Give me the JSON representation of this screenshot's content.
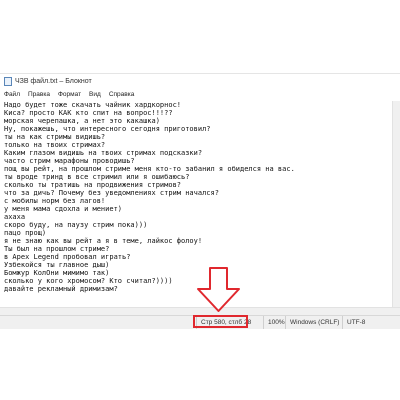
{
  "window": {
    "title": "ЧЗВ файл.txt – Блокнот"
  },
  "menu": {
    "items": [
      "Файл",
      "Правка",
      "Формат",
      "Вид",
      "Справка"
    ]
  },
  "editor": {
    "lines": [
      "Надо будет тоже скачать чайник хардкорнос!",
      "Киса? просто КАК кто спит на вопрос!!!??",
      "морская черепашка, а нет это какашка)",
      "Ну, покажешь, что интересного сегодня приготовил?",
      "ты на как стримы видишь?",
      "только на твоих стримах?",
      "Каким глазом видишь на твоих стримах подсказки?",
      "часто стрим марафоны проводишь?",
      "пощ вы рейт, на прошлом стриме меня кто-то забанил я обиделся на вас.",
      "ты вроде тринд в все стримил или я ошибаюсь?",
      "сколько ты тратишь на продвижения стримов?",
      "что за дичь? Почему без уведомлениях стрим начался?",
      "с мобилы норм без лагов!",
      "у меня мама сдохла и мениет)",
      "ахаха",
      "скоро буду, на паузу стрим пока)))",
      "пацо прощ)",
      "я не знаю как вы рейт а я в теме, лайкос фолоу!",
      "Ты был на прошлом стриме?",
      "в Apex Legend пробовал играть?",
      "Узбекойся ты главное дыш)",
      "Бомжур КолОни мимимо так)",
      "сколько у кого хромосом? Кто считал?))))",
      "давайте рекламный дримизам?"
    ]
  },
  "statusbar": {
    "position": "Стр 580, стлб 28",
    "zoom": "100%",
    "line_ending": "Windows (CRLF)",
    "encoding": "UTF-8"
  },
  "annotation": {
    "arrow_color": "#e0282e",
    "box_color": "#e0282e"
  }
}
